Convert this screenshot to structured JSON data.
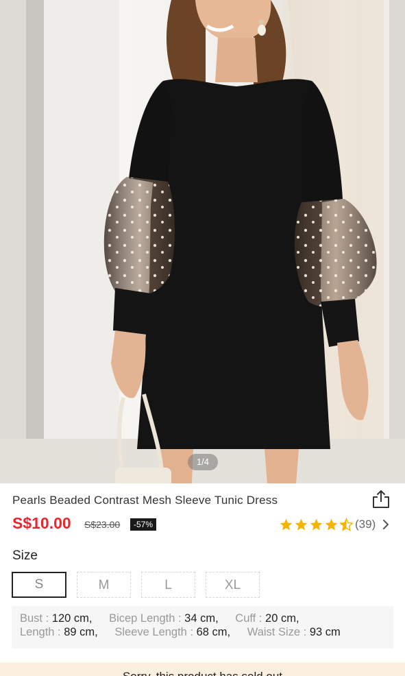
{
  "gallery": {
    "pager": "1/4"
  },
  "product": {
    "title": "Pearls Beaded Contrast Mesh Sleeve Tunic Dress",
    "price": "S$10.00",
    "original_price": "S$23.00",
    "discount": "-57%",
    "rating_value": 4.5,
    "review_count": "(39)"
  },
  "size": {
    "label": "Size",
    "options": [
      "S",
      "M",
      "L",
      "XL"
    ],
    "selected": "S"
  },
  "measurements": {
    "bust_label": "Bust :",
    "bust_value": "120 cm,",
    "bicep_label": "Bicep Length :",
    "bicep_value": "34 cm,",
    "cuff_label": "Cuff :",
    "cuff_value": "20 cm,",
    "length_label": "Length :",
    "length_value": "89 cm,",
    "sleeve_label": "Sleeve Length :",
    "sleeve_value": "68 cm,",
    "waist_label": "Waist Size :",
    "waist_value": "93 cm"
  },
  "notice": {
    "text": "Sorry, this product has sold out"
  },
  "colors": {
    "price_red": "#e8262f",
    "star_gold": "#f5b400",
    "discount_bg": "#1a1a1a",
    "banner_bg": "#fbefe0"
  },
  "icons": [
    "share-icon",
    "star-icon",
    "chevron-right-icon"
  ]
}
